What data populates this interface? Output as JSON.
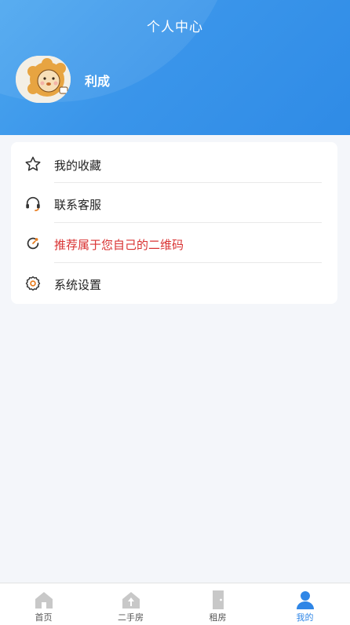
{
  "header": {
    "title": "个人中心"
  },
  "profile": {
    "name": "利成",
    "avatar_icon": "lion-avatar-icon"
  },
  "menu": {
    "items": [
      {
        "label": "我的收藏",
        "icon": "star-icon"
      },
      {
        "label": "联系客服",
        "icon": "headset-icon"
      },
      {
        "label": "推荐属于您自己的二维码",
        "icon": "refresh-circle-icon",
        "color": "#d93232"
      },
      {
        "label": "系统设置",
        "icon": "gear-icon"
      }
    ]
  },
  "tabbar": {
    "tabs": [
      {
        "label": "首页",
        "icon": "home-icon",
        "active": false
      },
      {
        "label": "二手房",
        "icon": "house-upload-icon",
        "active": false
      },
      {
        "label": "租房",
        "icon": "door-icon",
        "active": false
      },
      {
        "label": "我的",
        "icon": "user-icon",
        "active": true
      }
    ]
  },
  "colors": {
    "accent": "#2f86e6",
    "header_blue": "#3a95ea",
    "highlight_red": "#d93232"
  }
}
